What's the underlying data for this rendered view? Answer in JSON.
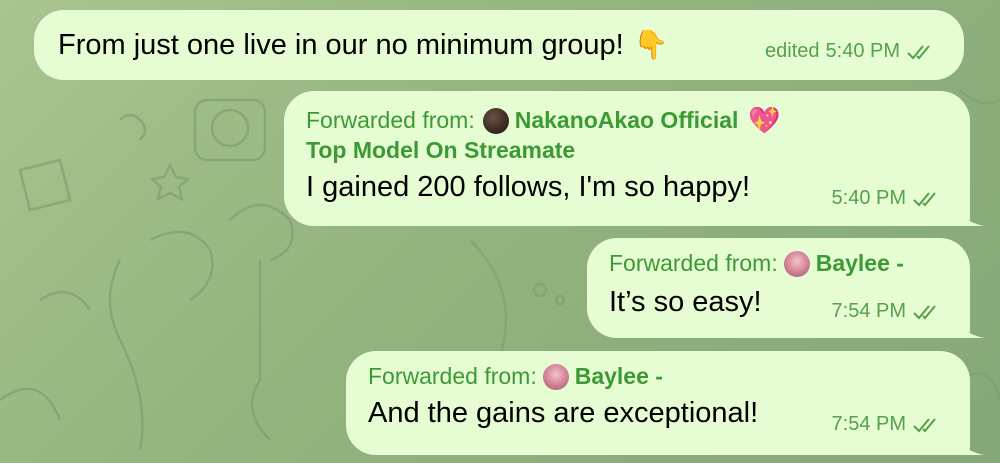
{
  "messages": [
    {
      "text": "From just one live in our no minimum group!",
      "emoji_icon": "backhand-index-pointing-down-icon",
      "edited_label": "edited",
      "time": "5:40 PM"
    },
    {
      "forward_label": "Forwarded from:",
      "forward_name": "NakanoAkao Official",
      "forward_emoji_icon": "sparkling-heart-icon",
      "forward_subtitle": "Top Model On Streamate",
      "text": "I gained 200 follows, I'm so happy!",
      "time": "5:40 PM"
    },
    {
      "forward_label": "Forwarded from:",
      "forward_name": "Baylee -",
      "text": "It’s so easy!",
      "time": "7:54 PM"
    },
    {
      "forward_label": "Forwarded from:",
      "forward_name": "Baylee -",
      "text": "And the gains are exceptional!",
      "time": "7:54 PM"
    }
  ],
  "colors": {
    "bubble": "#e6fcd2",
    "forward_accent": "#3c9a34",
    "meta": "#57a04c"
  }
}
